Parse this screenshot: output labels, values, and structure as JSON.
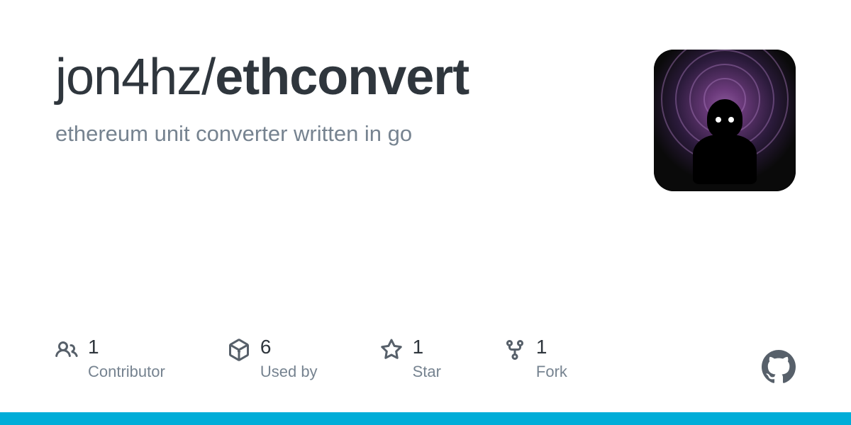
{
  "repo": {
    "owner": "jon4hz",
    "name": "ethconvert",
    "description": "ethereum unit converter written in go"
  },
  "stats": {
    "contributors": {
      "value": "1",
      "label": "Contributor"
    },
    "usedby": {
      "value": "6",
      "label": "Used by"
    },
    "stars": {
      "value": "1",
      "label": "Star"
    },
    "forks": {
      "value": "1",
      "label": "Fork"
    }
  },
  "colors": {
    "language_bar": "#00ADD8"
  }
}
